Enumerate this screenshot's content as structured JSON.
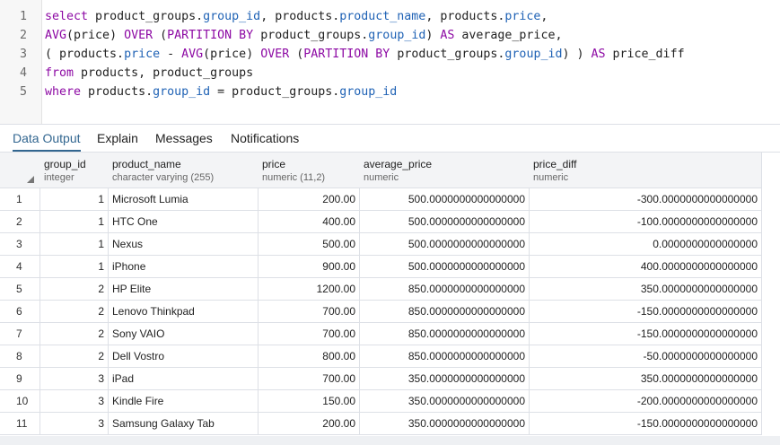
{
  "editor": {
    "lines": [
      {
        "n": "1",
        "tokens": [
          {
            "t": "select",
            "c": "kw"
          },
          {
            "t": " product_groups.",
            "c": ""
          },
          {
            "t": "group_id",
            "c": "fld"
          },
          {
            "t": ", products.",
            "c": ""
          },
          {
            "t": "product_name",
            "c": "fld"
          },
          {
            "t": ", products.",
            "c": ""
          },
          {
            "t": "price",
            "c": "fld"
          },
          {
            "t": ",",
            "c": ""
          }
        ]
      },
      {
        "n": "2",
        "tokens": [
          {
            "t": "AVG",
            "c": "fn"
          },
          {
            "t": "(price) ",
            "c": ""
          },
          {
            "t": "OVER",
            "c": "kw"
          },
          {
            "t": " (",
            "c": ""
          },
          {
            "t": "PARTITION BY",
            "c": "kw"
          },
          {
            "t": " product_groups.",
            "c": ""
          },
          {
            "t": "group_id",
            "c": "fld"
          },
          {
            "t": ") ",
            "c": ""
          },
          {
            "t": "AS",
            "c": "kw"
          },
          {
            "t": " average_price,",
            "c": ""
          }
        ]
      },
      {
        "n": "3",
        "tokens": [
          {
            "t": "( products.",
            "c": ""
          },
          {
            "t": "price",
            "c": "fld"
          },
          {
            "t": " - ",
            "c": ""
          },
          {
            "t": "AVG",
            "c": "fn"
          },
          {
            "t": "(price) ",
            "c": ""
          },
          {
            "t": "OVER",
            "c": "kw"
          },
          {
            "t": " (",
            "c": ""
          },
          {
            "t": "PARTITION BY",
            "c": "kw"
          },
          {
            "t": " product_groups.",
            "c": ""
          },
          {
            "t": "group_id",
            "c": "fld"
          },
          {
            "t": ") ) ",
            "c": ""
          },
          {
            "t": "AS",
            "c": "kw"
          },
          {
            "t": " price_diff",
            "c": ""
          }
        ]
      },
      {
        "n": "4",
        "tokens": [
          {
            "t": "from",
            "c": "kw"
          },
          {
            "t": " products, product_groups",
            "c": ""
          }
        ]
      },
      {
        "n": "5",
        "tokens": [
          {
            "t": "where",
            "c": "kw"
          },
          {
            "t": " products.",
            "c": ""
          },
          {
            "t": "group_id",
            "c": "fld"
          },
          {
            "t": " = product_groups.",
            "c": ""
          },
          {
            "t": "group_id",
            "c": "fld"
          }
        ]
      }
    ]
  },
  "tabs": [
    {
      "label": "Data Output",
      "active": true
    },
    {
      "label": "Explain",
      "active": false
    },
    {
      "label": "Messages",
      "active": false
    },
    {
      "label": "Notifications",
      "active": false
    }
  ],
  "grid": {
    "columns": [
      {
        "name": "group_id",
        "type": "integer"
      },
      {
        "name": "product_name",
        "type": "character varying (255)"
      },
      {
        "name": "price",
        "type": "numeric (11,2)"
      },
      {
        "name": "average_price",
        "type": "numeric"
      },
      {
        "name": "price_diff",
        "type": "numeric"
      }
    ],
    "rows": [
      [
        "1",
        "1",
        "Microsoft Lumia",
        "200.00",
        "500.0000000000000000",
        "-300.0000000000000000"
      ],
      [
        "2",
        "1",
        "HTC One",
        "400.00",
        "500.0000000000000000",
        "-100.0000000000000000"
      ],
      [
        "3",
        "1",
        "Nexus",
        "500.00",
        "500.0000000000000000",
        "0.0000000000000000"
      ],
      [
        "4",
        "1",
        "iPhone",
        "900.00",
        "500.0000000000000000",
        "400.0000000000000000"
      ],
      [
        "5",
        "2",
        "HP Elite",
        "1200.00",
        "850.0000000000000000",
        "350.0000000000000000"
      ],
      [
        "6",
        "2",
        "Lenovo Thinkpad",
        "700.00",
        "850.0000000000000000",
        "-150.0000000000000000"
      ],
      [
        "7",
        "2",
        "Sony VAIO",
        "700.00",
        "850.0000000000000000",
        "-150.0000000000000000"
      ],
      [
        "8",
        "2",
        "Dell Vostro",
        "800.00",
        "850.0000000000000000",
        "-50.0000000000000000"
      ],
      [
        "9",
        "3",
        "iPad",
        "700.00",
        "350.0000000000000000",
        "350.0000000000000000"
      ],
      [
        "10",
        "3",
        "Kindle Fire",
        "150.00",
        "350.0000000000000000",
        "-200.0000000000000000"
      ],
      [
        "11",
        "3",
        "Samsung Galaxy Tab",
        "200.00",
        "350.0000000000000000",
        "-150.0000000000000000"
      ]
    ]
  }
}
